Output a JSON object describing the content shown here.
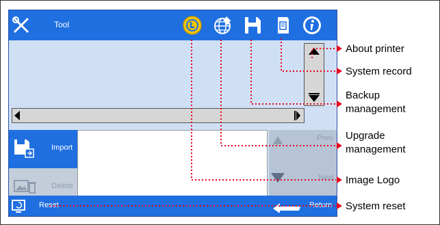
{
  "toolbar": {
    "title": "Tool",
    "icons": [
      "tools-icon",
      "image-logo-icon",
      "upgrade-globe-icon",
      "backup-disk-icon",
      "system-record-icon",
      "about-info-icon"
    ]
  },
  "panel": {
    "import_label": "Import",
    "delete_label": "Delete",
    "prev_label": "Prev.",
    "next_label": "Next"
  },
  "bottombar": {
    "reset_label": "Reset",
    "return_label": "Return"
  },
  "callouts": {
    "about_printer": "About printer",
    "system_record": "System record",
    "backup_line1": "Backup",
    "backup_line2": "management",
    "upgrade_line1": "Upgrade",
    "upgrade_line2": "management",
    "image_logo": "Image Logo",
    "system_reset": "System reset"
  },
  "colors": {
    "bar_blue": "#1f6fe0",
    "leader_red": "#e8001c",
    "logo_yellow": "#f2c500"
  }
}
